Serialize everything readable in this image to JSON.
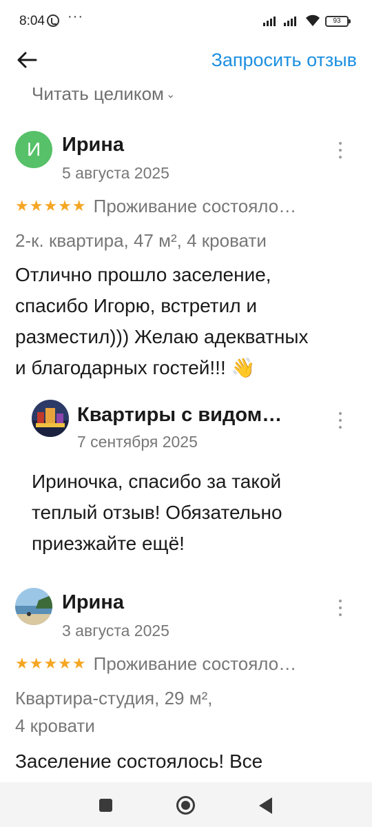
{
  "status_bar": {
    "time": "8:04",
    "dots": "···",
    "battery": "93"
  },
  "header": {
    "back_icon": "arrow-left-icon",
    "request_review": "Запросить отзыв"
  },
  "read_full": {
    "label": "Читать целиком",
    "chevron": "⌄"
  },
  "reviews": [
    {
      "avatar_letter": "И",
      "avatar_color": "#56c168",
      "author": "Ирина",
      "date": "5 августа 2025",
      "stars": "★★★★★",
      "rating_label": "Проживание состояло…",
      "meta": "2-к. квартира, 47 м², 4 кровати",
      "text_lines": [
        "Отлично прошло заселение,",
        "спасибо Игорю, встретил и",
        "разместил))) Желаю адекватных",
        "и благодарных гостей!!! 👋"
      ],
      "reply": {
        "author": "Квартиры с видом…",
        "date": "7 сентября 2025",
        "text_lines": [
          "Ириночка, спасибо за такой",
          "теплый отзыв! Обязательно",
          "приезжайте ещё!"
        ]
      }
    },
    {
      "author": "Ирина",
      "date": "3 августа 2025",
      "stars": "★★★★★",
      "rating_label": "Проживание состояло…",
      "meta_lines": [
        "Квартира-студия, 29 м²,",
        "4 кровати"
      ],
      "text_lines": [
        "Заселение состоялось! Все"
      ]
    }
  ],
  "colors": {
    "accent": "#1c8fe0",
    "star": "#f5a623",
    "muted": "#777777"
  }
}
